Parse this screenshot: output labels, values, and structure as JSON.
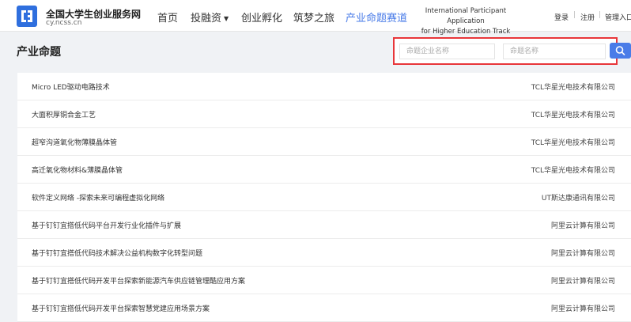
{
  "site": {
    "name": "全国大学生创业服务网",
    "url": "cy.ncss.cn"
  },
  "nav": {
    "items": [
      {
        "label": "首页"
      },
      {
        "label": "投融资"
      },
      {
        "label": "创业孵化"
      },
      {
        "label": "筑梦之旅"
      },
      {
        "label": "产业命题赛道"
      }
    ],
    "sub_line1": "International Participant Application",
    "sub_line2": "for Higher Education Track"
  },
  "user_links": {
    "login": "登录",
    "register": "注册",
    "admin": "管理入口",
    "separator": "|"
  },
  "page": {
    "title": "产业命题"
  },
  "search": {
    "company_placeholder": "命题企业名称",
    "topic_placeholder": "命题名称"
  },
  "rows": [
    {
      "title": "Micro LED驱动电路技术",
      "company": "TCL华星光电技术有限公司"
    },
    {
      "title": "大面积厚铜合金工艺",
      "company": "TCL华星光电技术有限公司"
    },
    {
      "title": "超窄沟道氧化物薄膜晶体管",
      "company": "TCL华星光电技术有限公司"
    },
    {
      "title": "高迁氧化物材料&薄膜晶体管",
      "company": "TCL华星光电技术有限公司"
    },
    {
      "title": "软件定义网络 -探索未来可编程虚拟化网络",
      "company": "UT斯达康通讯有限公司"
    },
    {
      "title": "基于钉钉宜搭低代码平台开发行业化插件与扩展",
      "company": "阿里云计算有限公司"
    },
    {
      "title": "基于钉钉宜搭低代码技术解决公益机构数字化转型问题",
      "company": "阿里云计算有限公司"
    },
    {
      "title": "基于钉钉宜搭低代码开发平台探索新能源汽车供应链管理酷应用方案",
      "company": "阿里云计算有限公司"
    },
    {
      "title": "基于钉钉宜搭低代码开发平台探索智慧党建应用场景方案",
      "company": "阿里云计算有限公司"
    }
  ],
  "colors": {
    "accent": "#4a7ce8",
    "logo": "#2f6fde",
    "highlight_border": "#e8363a"
  },
  "icons": {
    "logo": "logo-icon",
    "search": "search-icon",
    "dropdown": "caret-down-icon"
  }
}
